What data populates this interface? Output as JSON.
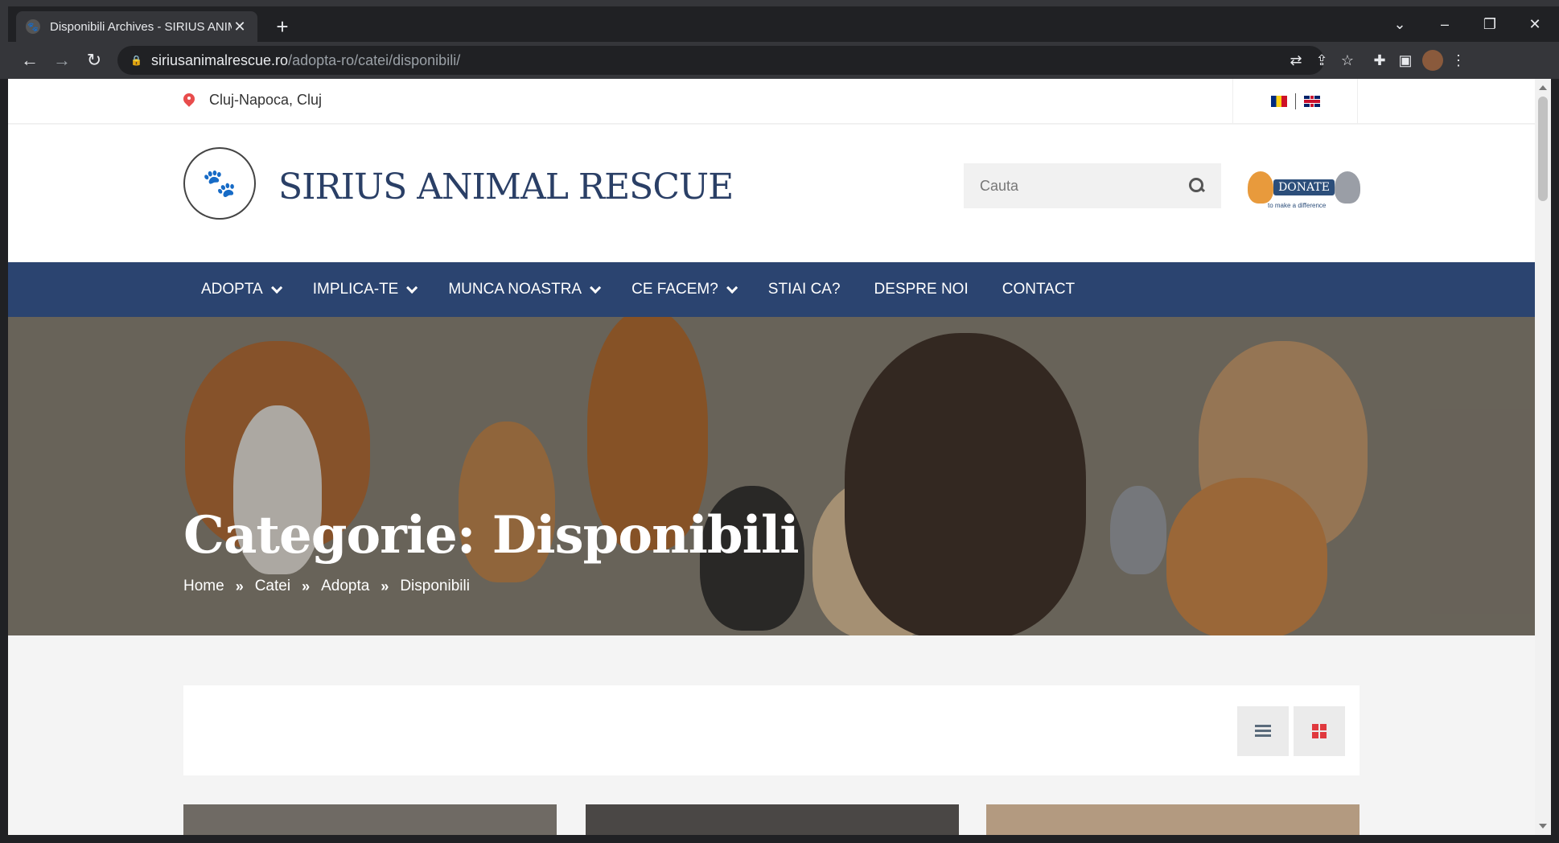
{
  "browser": {
    "tab_title": "Disponibili Archives - SIRIUS ANIMAL RESCUE",
    "url_host": "siriusanimalrescue.ro",
    "url_path": "/adopta-ro/catei/disponibili/"
  },
  "topbar": {
    "location": "Cluj-Napoca, Cluj"
  },
  "header": {
    "site_title": "SIRIUS ANIMAL RESCUE",
    "search_placeholder": "Cauta",
    "donate_label": "DONATE",
    "donate_sub": "to make a difference"
  },
  "nav": {
    "items": [
      {
        "label": "ADOPTA",
        "has_dropdown": true
      },
      {
        "label": "IMPLICA-TE",
        "has_dropdown": true
      },
      {
        "label": "MUNCA NOASTRA",
        "has_dropdown": true
      },
      {
        "label": "CE FACEM?",
        "has_dropdown": true
      },
      {
        "label": "STIAI CA?",
        "has_dropdown": false
      },
      {
        "label": "DESPRE NOI",
        "has_dropdown": false
      },
      {
        "label": "CONTACT",
        "has_dropdown": false
      }
    ]
  },
  "hero": {
    "title": "Categorie: Disponibili",
    "breadcrumbs": [
      "Home",
      "Catei",
      "Adopta",
      "Disponibili"
    ]
  },
  "colors": {
    "nav_bg": "#2b4470",
    "title_color": "#2a3f66",
    "accent_red": "#e0393e"
  }
}
